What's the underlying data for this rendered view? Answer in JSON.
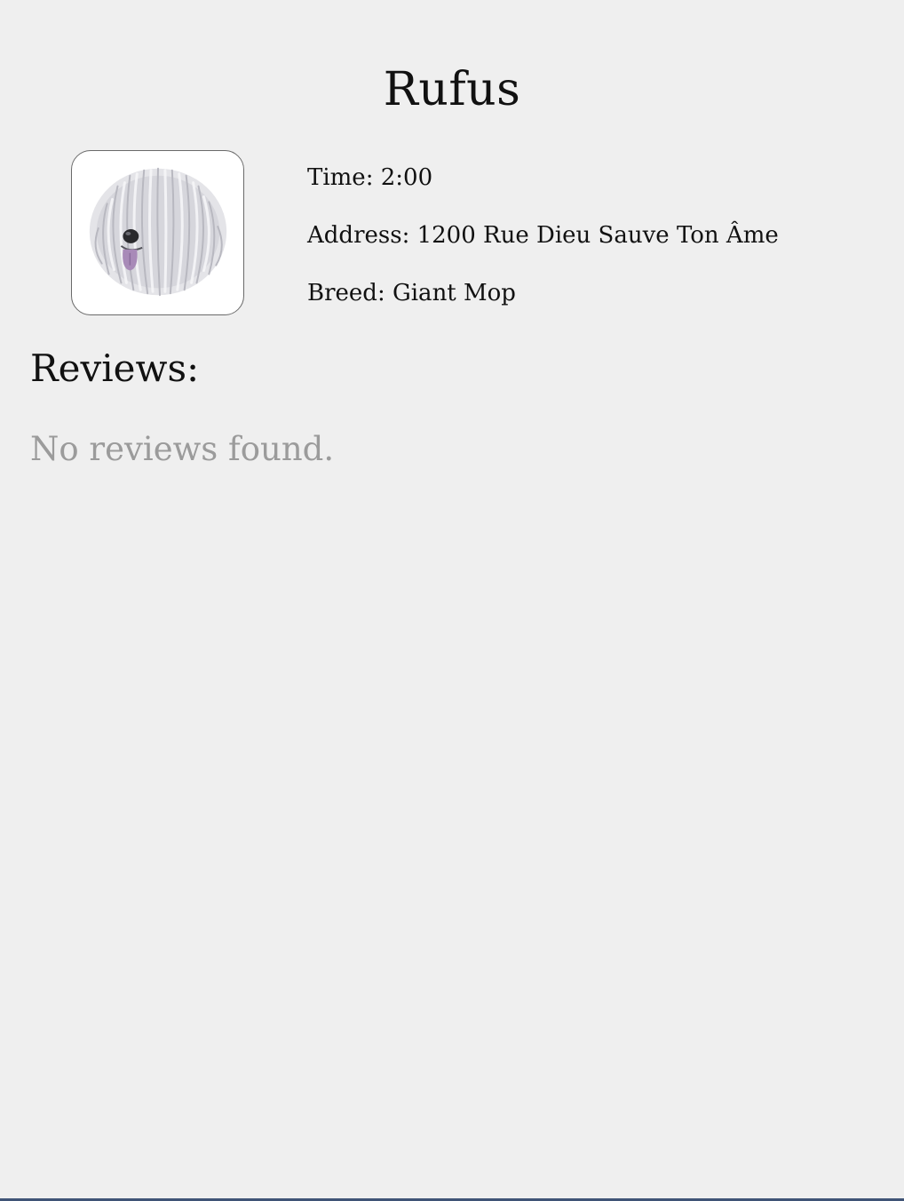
{
  "pet": {
    "name": "Rufus",
    "photo_icon": "shaggy-dog-icon"
  },
  "details": {
    "time": "Time: 2:00",
    "address": "Address: 1200 Rue Dieu Sauve Ton Âme",
    "breed": "Breed: Giant Mop"
  },
  "reviews": {
    "heading": "Reviews:",
    "empty_message": "No reviews found."
  },
  "colors": {
    "background": "#efefef",
    "text": "#111111",
    "muted_text": "#9b9b9b",
    "frame_border": "#6a6a6a",
    "bottom_edge": "#3f5376"
  }
}
